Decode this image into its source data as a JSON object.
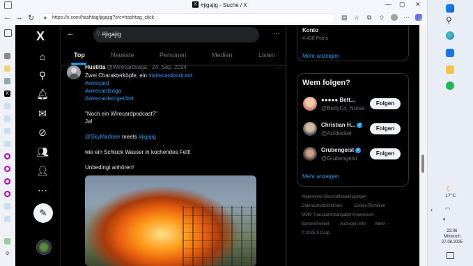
{
  "browser": {
    "tab_title": "#jigajig - Suche / X",
    "url": "https://x.com/hashtag/jigajig?src=hashtag_click",
    "x_badge": "X"
  },
  "x": {
    "logo": "X",
    "back_icon": "←",
    "search_query": "#jigajig",
    "more": "···",
    "tabs": [
      "Top",
      "Neueste",
      "Personen",
      "Medien",
      "Listen"
    ],
    "nav_icons": [
      "home-icon",
      "explore-icon",
      "notifications-icon",
      "messages-icon",
      "grok-icon",
      "communities-icon",
      "profile-icon",
      "more-icon"
    ]
  },
  "tweet": {
    "name": "Hustitia",
    "meta": "@Wirecardsaga · 24. Sep. 2024",
    "line1_pre": "Zwei Charakterköpfe, ein ",
    "line1_link": "#wirecardpodcast",
    "hashtags": [
      "#wirecard",
      "#wirecardsaga",
      "#wirecardeingetütet"
    ],
    "quote": "\"Noch ein Wirecardpodcast?\"",
    "ja": "Ja!",
    "mention": "@SkyMartiner",
    "meets": " meets ",
    "tag": "#jigajig",
    "line_water": "wie ein Schluck Wasser in kochendes Fett!",
    "line_listen": "Unbedingt anhören!",
    "more": "···"
  },
  "right": {
    "konto_title": "Konto",
    "konto_posts": "4.438 Posts",
    "show_more": "Mehr anzeigen",
    "who_title": "Wem folgen?",
    "who": [
      {
        "name": "●●●●● Bett...",
        "handle": "@BettyCo_Nurse",
        "verified": false,
        "button": "Folgen"
      },
      {
        "name": "Christian H...",
        "handle": "@Aufdecker",
        "verified": true,
        "button": "Folgen"
      },
      {
        "name": "Grubengeist",
        "handle": "@Grubengeist",
        "verified": true,
        "button": "Folgen"
      }
    ],
    "who_more": "Mehr anzeigen",
    "footer": [
      "Allgemeine Geschäftsbedingungen",
      "Datenschutzrichtlinien",
      "Cookie-Richtlinie",
      "MStV Transparenzangaben",
      "Impressum",
      "Barrierefreiheit",
      "Anzeigen-info",
      "Mehr ···",
      "© 2025 X Corp."
    ]
  },
  "windows": {
    "weather": "17°C",
    "time": "23:06",
    "day": "Mittwoch",
    "date": "27.08.2025"
  }
}
